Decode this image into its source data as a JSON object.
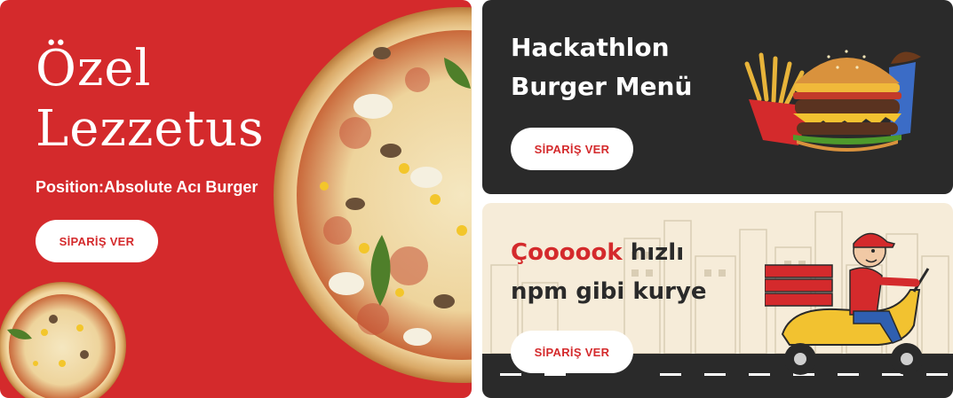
{
  "cards": {
    "special": {
      "title_line1": "Özel",
      "title_line2": "Lezzetus",
      "subtitle": "Position:Absolute Acı Burger",
      "cta_label": "SİPARİŞ VER",
      "image_icon": "pizza-image"
    },
    "burger": {
      "title_line1": "Hackathlon",
      "title_line2": "Burger Menü",
      "cta_label": "SİPARİŞ VER",
      "image_icon": "burger-menu-image"
    },
    "courier": {
      "title_accent": "Çoooook",
      "title_rest_line1": " hızlı",
      "title_line2": "npm gibi kurye",
      "cta_label": "SİPARİŞ VER",
      "image_icon": "courier-scooter-image"
    }
  },
  "colors": {
    "brand_red": "#d42a2c",
    "dark": "#2a2a2a",
    "cream": "#f6ecd9",
    "white": "#ffffff"
  }
}
